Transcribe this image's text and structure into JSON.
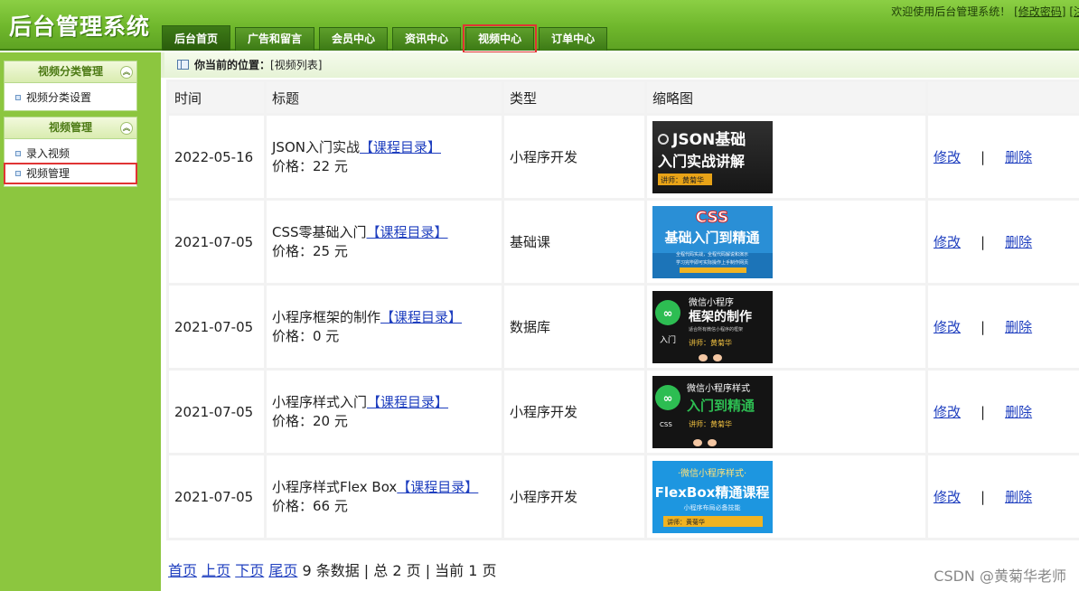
{
  "app": {
    "title": "后台管理系统"
  },
  "header": {
    "welcome_text": "欢迎使用后台管理系统！",
    "change_password": "[修改密码]",
    "logout_partial": "[注"
  },
  "nav": {
    "tabs": [
      {
        "label": "后台首页",
        "active": true
      },
      {
        "label": "广告和留言"
      },
      {
        "label": "会员中心"
      },
      {
        "label": "资讯中心"
      },
      {
        "label": "视频中心",
        "highlighted": true
      },
      {
        "label": "订单中心"
      }
    ]
  },
  "sidebar": {
    "groups": [
      {
        "title": "视频分类管理",
        "items": [
          {
            "label": "视频分类设置"
          }
        ]
      },
      {
        "title": "视频管理",
        "items": [
          {
            "label": "录入视频"
          },
          {
            "label": "视频管理",
            "highlighted": true
          }
        ]
      }
    ]
  },
  "breadcrumb": {
    "prefix": "你当前的位置：",
    "path": "[视频列表]"
  },
  "table": {
    "headers": [
      "时间",
      "标题",
      "类型",
      "缩略图",
      ""
    ],
    "catalog_link": "【课程目录】",
    "edit_label": "修改",
    "delete_label": "删除",
    "separator": "|",
    "rows": [
      {
        "date": "2022-05-16",
        "title": "JSON入门实战",
        "price": "价格：22 元",
        "type": "小程序开发",
        "thumb": {
          "line1": "JSON基础",
          "line2": "入门实战讲解",
          "line3": "讲师：黄菊华"
        }
      },
      {
        "date": "2021-07-05",
        "title": "CSS零基础入门",
        "price": "价格：25 元",
        "type": "基础课",
        "thumb": {
          "line1": "CSS",
          "line2": "基础入门到精通",
          "line3": "全程代码实战，全程代码解说和演示",
          "line4": "学习完毕即可实际操作上手制作网页"
        }
      },
      {
        "date": "2021-07-05",
        "title": "小程序框架的制作",
        "price": "价格：0 元",
        "type": "数据库",
        "thumb": {
          "line1": "微信小程序",
          "line2": "框架的制作",
          "line3": "适合所有微信小程序的框架",
          "line4": "入门",
          "line5": "讲师：黄菊华"
        }
      },
      {
        "date": "2021-07-05",
        "title": "小程序样式入门",
        "price": "价格：20 元",
        "type": "小程序开发",
        "thumb": {
          "line1": "微信小程序样式",
          "line2": "入门到精通",
          "line3": "CSS",
          "line4": "讲师：黄菊华"
        }
      },
      {
        "date": "2021-07-05",
        "title": "小程序样式Flex Box",
        "price": "价格：66 元",
        "type": "小程序开发",
        "thumb": {
          "line1": "·微信小程序样式·",
          "line2": "FlexBox精通课程",
          "line3": "小程序布局必备技能",
          "line4": "讲师：黄菊华"
        }
      }
    ]
  },
  "pager": {
    "first": "首页",
    "prev": "上页",
    "next": "下页",
    "last": "尾页",
    "summary": "9 条数据 | 总 2 页 | 当前 1 页"
  },
  "watermark": "CSDN @黄菊华老师",
  "colors": {
    "header_green": "#6fb72c",
    "sidebar_green": "#8cc63f",
    "highlight_red": "#e03434",
    "link_blue": "#1f3fbf"
  }
}
